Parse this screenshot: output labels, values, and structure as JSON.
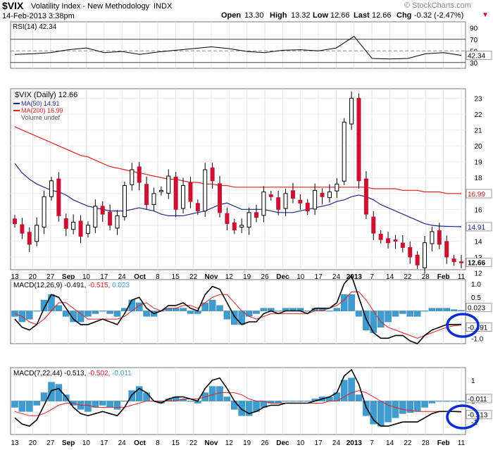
{
  "header": {
    "symbol": "$VIX",
    "name": "Volatility Index - New Methodology",
    "exchange": "INDX",
    "datetime": "14-Feb-2013 3:38pm",
    "copyright": "© StockCharts.com",
    "open_label": "Open",
    "open": "13.30",
    "high_label": "High",
    "high": "13.32",
    "low_label": "Low",
    "low": "12.66",
    "last_label": "Last",
    "last": "12.66",
    "chg_label": "Chg",
    "chg": "-0.32 (-2.47%)",
    "chg_arrow": "▼"
  },
  "colors": {
    "up_candle": "#ffffff",
    "down_candle": "#cc1133",
    "ma50": "#1a2a8a",
    "ma200": "#dd2222",
    "histogram": "#3f9cd0",
    "macd_line": "#000000",
    "signal_line": "#dd2222",
    "highlight_circle": "#0a2bd8"
  },
  "chart_data": [
    {
      "type": "line",
      "panel": "rsi",
      "legend": "RSI(14) 42.34",
      "y_ticks": [
        "90",
        "70",
        "50",
        "30"
      ],
      "ylim": [
        20,
        100
      ],
      "reference_lines": [
        70,
        50,
        30
      ],
      "last_label": "42.34",
      "x": [
        "13",
        "20",
        "27",
        "Sep",
        "10",
        "17",
        "24",
        "Oct",
        "8",
        "15",
        "22",
        "Nov",
        "12",
        "19",
        "26",
        "Dec",
        "10",
        "17",
        "24",
        "2013",
        "7",
        "14",
        "22",
        "28",
        "Feb",
        "11"
      ],
      "values": [
        44,
        45,
        47,
        52,
        55,
        47,
        49,
        44,
        48,
        51,
        54,
        57,
        54,
        49,
        47,
        51,
        52,
        50,
        55,
        75,
        37,
        36,
        37,
        45,
        47,
        42.34
      ]
    },
    {
      "type": "candlestick",
      "panel": "price",
      "legend": [
        "$VIX (Daily) 12.66",
        "MA(50) 14.91",
        "MA(200) 16.99",
        "Volume undef"
      ],
      "y_ticks": [
        "23",
        "22",
        "21",
        "20",
        "19",
        "18",
        "17",
        "16",
        "15",
        "14",
        "13",
        "12"
      ],
      "ylim": [
        12.2,
        23.6
      ],
      "last_labels": {
        "ma200": "16.99",
        "ma50": "14.91",
        "price": "12.66"
      },
      "x_ticks": [
        "13",
        "20",
        "27",
        "Sep",
        "10",
        "17",
        "24",
        "Oct",
        "8",
        "15",
        "22",
        "Nov",
        "12",
        "19",
        "26",
        "Dec",
        "10",
        "17",
        "24",
        "2013",
        "7",
        "14",
        "22",
        "28",
        "Feb",
        "11"
      ],
      "close": [
        15.1,
        14.5,
        13.8,
        15.0,
        16.8,
        17.8,
        15.6,
        14.8,
        15.2,
        14.3,
        15.0,
        16.2,
        15.7,
        15.0,
        15.6,
        17.5,
        18.5,
        17.7,
        16.3,
        17.0,
        17.2,
        18.1,
        16.0,
        17.5,
        16.5,
        15.9,
        18.5,
        17.8,
        15.8,
        15.1,
        14.7,
        15.0,
        15.8,
        15.5,
        17.1,
        16.8,
        16.0,
        17.0,
        16.7,
        16.4,
        15.9,
        17.2,
        16.8,
        17.1,
        17.6,
        21.5,
        23.0,
        17.8,
        15.7,
        14.5,
        14.1,
        13.9,
        14.0,
        13.6,
        13.0,
        12.5,
        13.9,
        14.6,
        13.8,
        13.0,
        12.7,
        12.66
      ],
      "ma50": [
        18.9,
        18.3,
        17.9,
        17.6,
        17.4,
        17.2,
        17.1,
        16.9,
        16.6,
        16.4,
        16.2,
        16.1,
        16.0,
        15.9,
        15.9,
        15.9,
        16.0,
        16.1,
        16.0,
        15.9,
        15.7,
        15.6,
        15.6,
        15.6,
        15.7,
        15.8,
        15.9,
        16.1,
        16.3,
        16.4,
        16.2,
        16.0,
        16.0,
        16.0,
        16.0,
        15.9,
        15.8,
        15.8,
        15.8,
        15.9,
        16.0,
        16.1,
        16.2,
        16.3,
        16.5,
        16.6,
        16.8,
        16.9,
        16.8,
        16.6,
        16.3,
        16.1,
        15.9,
        15.7,
        15.5,
        15.3,
        15.1,
        15.0,
        14.95,
        14.93,
        14.92,
        14.91
      ],
      "ma200": [
        21.2,
        21.0,
        20.8,
        20.6,
        20.4,
        20.2,
        20.0,
        19.8,
        19.6,
        19.4,
        19.3,
        19.1,
        18.9,
        18.7,
        18.6,
        18.5,
        18.4,
        18.3,
        18.2,
        18.1,
        18.0,
        17.9,
        17.9,
        17.8,
        17.7,
        17.7,
        17.6,
        17.6,
        17.5,
        17.5,
        17.4,
        17.4,
        17.4,
        17.4,
        17.4,
        17.4,
        17.4,
        17.4,
        17.4,
        17.4,
        17.4,
        17.4,
        17.4,
        17.4,
        17.4,
        17.4,
        17.4,
        17.4,
        17.4,
        17.3,
        17.3,
        17.3,
        17.3,
        17.2,
        17.2,
        17.2,
        17.1,
        17.1,
        17.1,
        17.0,
        17.0,
        16.99
      ]
    },
    {
      "type": "line",
      "panel": "macd1",
      "legend_label": "MACD(12,26,9)",
      "legend_values": [
        "-0.491",
        "-0.515",
        "0.023"
      ],
      "y_ticks": [
        "1.0",
        "0.5",
        "-1.0"
      ],
      "ylim": [
        -1.2,
        1.15
      ],
      "last_labels": {
        "histogram": "0.023",
        "macd": "-0.491"
      },
      "macd": [
        -0.3,
        -0.6,
        -0.7,
        -0.5,
        0.1,
        0.6,
        0.5,
        0.1,
        -0.3,
        -0.5,
        -0.5,
        -0.4,
        -0.3,
        -0.4,
        -0.5,
        -0.1,
        0.4,
        0.5,
        0.1,
        -0.1,
        0.0,
        0.2,
        0.2,
        0.3,
        0.1,
        0.0,
        0.6,
        0.9,
        0.8,
        0.3,
        -0.2,
        -0.5,
        -0.4,
        -0.4,
        -0.1,
        0.0,
        -0.1,
        0.0,
        0.0,
        0.0,
        -0.1,
        0.1,
        0.1,
        0.1,
        0.3,
        1.0,
        1.3,
        0.5,
        -0.3,
        -0.8,
        -1.0,
        -1.0,
        -0.9,
        -0.9,
        -1.1,
        -1.2,
        -0.9,
        -0.7,
        -0.6,
        -0.5,
        -0.5,
        -0.491
      ],
      "signal": [
        -0.1,
        -0.2,
        -0.4,
        -0.5,
        -0.3,
        0.0,
        0.3,
        0.3,
        0.1,
        -0.1,
        -0.3,
        -0.3,
        -0.3,
        -0.3,
        -0.3,
        -0.2,
        0.0,
        0.2,
        0.3,
        0.1,
        0.0,
        0.1,
        0.1,
        0.2,
        0.2,
        0.1,
        0.3,
        0.5,
        0.6,
        0.6,
        0.3,
        0.0,
        -0.2,
        -0.3,
        -0.2,
        -0.1,
        -0.1,
        -0.1,
        -0.1,
        -0.1,
        -0.1,
        0.0,
        0.0,
        0.1,
        0.2,
        0.4,
        0.7,
        0.7,
        0.4,
        0.0,
        -0.4,
        -0.6,
        -0.7,
        -0.8,
        -0.9,
        -1.0,
        -0.9,
        -0.8,
        -0.7,
        -0.6,
        -0.55,
        -0.515
      ]
    },
    {
      "type": "line",
      "panel": "macd2",
      "legend_label": "MACD(7,22,44)",
      "legend_values": [
        "-0.513",
        "-0.502",
        "-0.011"
      ],
      "y_ticks": [
        "1",
        "0",
        "-1"
      ],
      "ylim": [
        -1.6,
        1.6
      ],
      "last_labels": {
        "histogram": "-0.011",
        "macd": "-0.513"
      },
      "macd": [
        -0.8,
        -1.1,
        -1.2,
        -0.9,
        -0.2,
        0.5,
        0.6,
        0.2,
        -0.3,
        -0.6,
        -0.7,
        -0.6,
        -0.5,
        -0.6,
        -0.7,
        -0.3,
        0.3,
        0.6,
        0.4,
        0.0,
        -0.1,
        0.1,
        0.2,
        0.2,
        0.1,
        0.0,
        0.6,
        1.0,
        1.1,
        0.6,
        0.0,
        -0.4,
        -0.6,
        -0.5,
        -0.3,
        -0.2,
        -0.2,
        -0.1,
        -0.1,
        -0.1,
        -0.1,
        0.0,
        0.1,
        0.2,
        0.4,
        1.2,
        1.5,
        0.8,
        -0.3,
        -0.9,
        -1.2,
        -1.2,
        -1.1,
        -1.0,
        -1.0,
        -1.0,
        -0.8,
        -0.6,
        -0.5,
        -0.5,
        -0.5,
        -0.513
      ],
      "signal": [
        -0.5,
        -0.6,
        -0.7,
        -0.7,
        -0.6,
        -0.4,
        -0.2,
        -0.1,
        -0.1,
        -0.2,
        -0.2,
        -0.3,
        -0.3,
        -0.3,
        -0.3,
        -0.3,
        -0.2,
        -0.1,
        0.0,
        0.0,
        0.0,
        0.0,
        0.0,
        0.1,
        0.1,
        0.1,
        0.2,
        0.3,
        0.4,
        0.4,
        0.4,
        0.3,
        0.1,
        0.0,
        0.0,
        -0.1,
        -0.1,
        -0.1,
        -0.1,
        -0.1,
        -0.1,
        -0.1,
        -0.1,
        0.0,
        0.0,
        0.2,
        0.4,
        0.5,
        0.4,
        0.2,
        0.0,
        -0.2,
        -0.3,
        -0.4,
        -0.45,
        -0.5,
        -0.5,
        -0.5,
        -0.5,
        -0.5,
        -0.5,
        -0.502
      ]
    }
  ]
}
